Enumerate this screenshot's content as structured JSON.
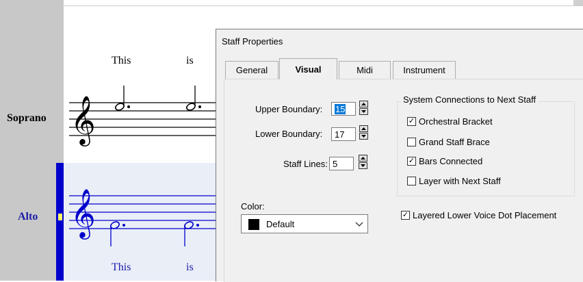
{
  "score": {
    "staves": [
      {
        "name": "Soprano",
        "color": "#000000"
      },
      {
        "name": "Alto",
        "color": "#0000cc"
      }
    ],
    "lyrics_top": [
      "This",
      "is"
    ],
    "lyrics_bottom": [
      "This",
      "is"
    ]
  },
  "dialog": {
    "title": "Staff Properties",
    "tabs": [
      {
        "label": "General",
        "active": false
      },
      {
        "label": "Visual",
        "active": true
      },
      {
        "label": "Midi",
        "active": false
      },
      {
        "label": "Instrument",
        "active": false
      }
    ],
    "fields": {
      "upper_boundary": {
        "label": "Upper Boundary:",
        "value": "15"
      },
      "lower_boundary": {
        "label": "Lower Boundary:",
        "value": "17"
      },
      "staff_lines": {
        "label": "Staff Lines:",
        "value": "5"
      }
    },
    "system_connections": {
      "title": "System Connections to Next Staff",
      "items": [
        {
          "label": "Orchestral Bracket",
          "checked": true
        },
        {
          "label": "Grand Staff Brace",
          "checked": false
        },
        {
          "label": "Bars Connected",
          "checked": true
        },
        {
          "label": "Layer with Next Staff",
          "checked": false
        }
      ]
    },
    "color": {
      "label": "Color:",
      "value": "Default",
      "swatch": "#000000"
    },
    "layered_dot": {
      "label": "Layered Lower Voice Dot Placement",
      "checked": true
    }
  }
}
